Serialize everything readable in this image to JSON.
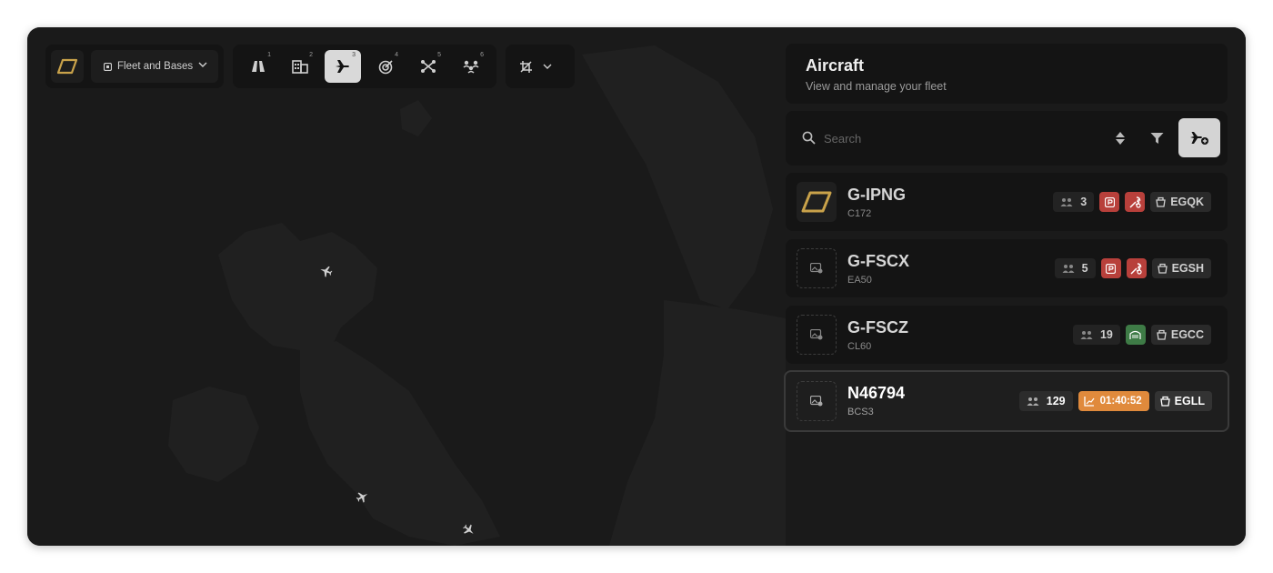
{
  "colors": {
    "brand": "#c9a24a",
    "active_tool": "#d9d9d9",
    "alert": "#b8403b",
    "ok": "#3e7b46",
    "airborne": "#e08a3c"
  },
  "toolbar": {
    "logo_icon": "brand-logo",
    "context_selector": {
      "icon": "square-icon",
      "label": "Fleet and Bases"
    },
    "tools": [
      {
        "icon": "road-icon",
        "shortcut": "1"
      },
      {
        "icon": "building-icon",
        "shortcut": "2"
      },
      {
        "icon": "plane-icon",
        "shortcut": "3",
        "active": true
      },
      {
        "icon": "target-icon",
        "shortcut": "4"
      },
      {
        "icon": "drone-icon",
        "shortcut": "5"
      },
      {
        "icon": "people-icon",
        "shortcut": "6"
      }
    ],
    "crop_tool": {
      "icon": "crop-icon"
    }
  },
  "sidebar": {
    "title": "Aircraft",
    "subtitle": "View and manage your fleet",
    "search": {
      "placeholder": "Search",
      "value": ""
    },
    "aircraft": [
      {
        "registration": "G-IPNG",
        "type": "C172",
        "pax": "3",
        "flags": [
          "parking",
          "maintenance"
        ],
        "base": "EGQK",
        "thumb": "brand-logo"
      },
      {
        "registration": "G-FSCX",
        "type": "EA50",
        "pax": "5",
        "flags": [
          "parking",
          "maintenance"
        ],
        "base": "EGSH",
        "thumb": "no-image"
      },
      {
        "registration": "G-FSCZ",
        "type": "CL60",
        "pax": "19",
        "flags": [
          "hangar"
        ],
        "base": "EGCC",
        "thumb": "no-image"
      },
      {
        "registration": "N46794",
        "type": "BCS3",
        "pax": "129",
        "timer": "01:40:52",
        "base": "EGLL",
        "thumb": "no-image",
        "selected": true
      }
    ]
  }
}
